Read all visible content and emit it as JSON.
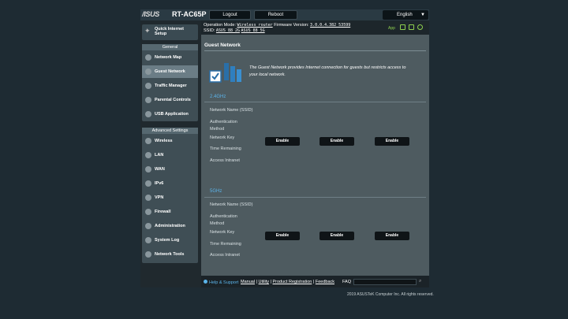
{
  "header": {
    "brand": "/ISUS",
    "model": "RT-AC65P",
    "logout": "Logout",
    "reboot": "Reboot",
    "language": "English"
  },
  "status": {
    "mode_label": "Operation Mode:",
    "mode_value": "Wireless router",
    "fw_label": "Firmware Version:",
    "fw_value": "3.0.0.4.382_53599",
    "ssid_label": "SSID:",
    "ssid_24": "ASUS_88_2G",
    "ssid_5": "ASUS_88_5G",
    "app_label": "App",
    "accent": "#8fd14f"
  },
  "sidebar": {
    "qis": "Quick Internet Setup",
    "general_header": "General",
    "general": [
      {
        "label": "Network Map",
        "icon": "globe-icon"
      },
      {
        "label": "Guest Network",
        "icon": "guest-icon"
      },
      {
        "label": "Traffic Manager",
        "icon": "traffic-icon"
      },
      {
        "label": "Parental Controls",
        "icon": "lock-icon"
      },
      {
        "label": "USB Application",
        "icon": "usb-icon"
      }
    ],
    "advanced_header": "Advanced Settings",
    "advanced": [
      {
        "label": "Wireless",
        "icon": "wifi-icon"
      },
      {
        "label": "LAN",
        "icon": "house-icon"
      },
      {
        "label": "WAN",
        "icon": "globe-icon"
      },
      {
        "label": "IPv6",
        "icon": "ipv6-icon"
      },
      {
        "label": "VPN",
        "icon": "vpn-icon"
      },
      {
        "label": "Firewall",
        "icon": "firewall-icon"
      },
      {
        "label": "Administration",
        "icon": "admin-icon"
      },
      {
        "label": "System Log",
        "icon": "log-icon"
      },
      {
        "label": "Network Tools",
        "icon": "tools-icon"
      }
    ]
  },
  "main": {
    "title": "Guest Network",
    "description": "The Guest Network provides Internet connection for guests but restricts access to your local network.",
    "bands": [
      {
        "name": "2.4GHz",
        "rows": [
          "Network Name (SSID)",
          "Authentication Method",
          "Network Key",
          "Time Remaining",
          "Access Intranet"
        ],
        "buttons": [
          "Enable",
          "Enable",
          "Enable"
        ]
      },
      {
        "name": "5GHz",
        "rows": [
          "Network Name (SSID)",
          "Authentication Method",
          "Network Key",
          "Time Remaining",
          "Access Intranet"
        ],
        "buttons": [
          "Enable",
          "Enable",
          "Enable"
        ]
      }
    ]
  },
  "footer": {
    "help": "Help & Support",
    "manual": "Manual",
    "utility": "Utility",
    "product_reg": "Product Registration",
    "feedback": "Feedback",
    "faq": "FAQ",
    "copyright": "2019 ASUSTeK Computer Inc. All rights reserved."
  }
}
